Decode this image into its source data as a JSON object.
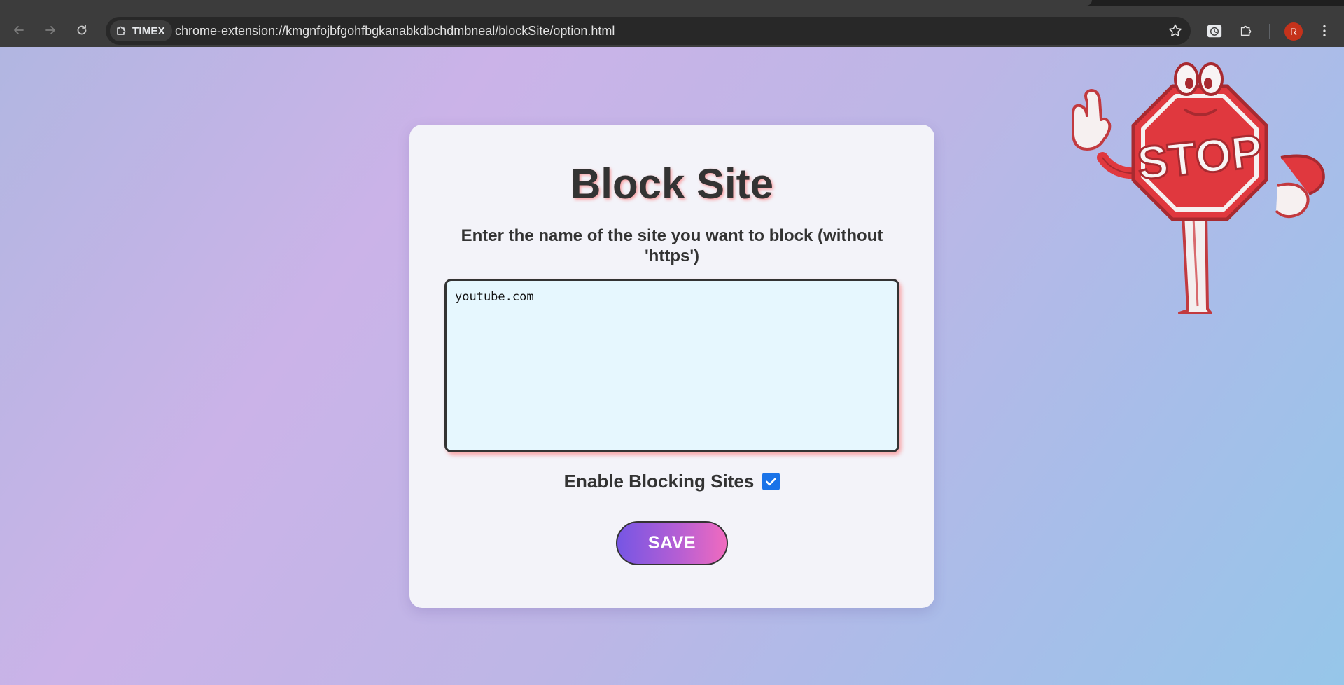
{
  "browser": {
    "site_chip_label": "TIMEX",
    "url": "chrome-extension://kmgnfojbfgohfbgkanabkdbchdmbneal/blockSite/option.html",
    "profile_initial": "R",
    "icons": [
      "back-arrow-icon",
      "forward-arrow-icon",
      "reload-icon",
      "extension-puzzle-icon",
      "bookmark-star-icon",
      "timer-extension-icon",
      "extensions-icon",
      "kebab-menu-icon"
    ]
  },
  "page": {
    "title": "Block Site",
    "instructions": "Enter the name of the site you want to block (without 'https')",
    "sites_value": "youtube.com",
    "enable_label": "Enable Blocking Sites",
    "enable_checked": true,
    "save_label": "SAVE",
    "stop_sign_text": "STOP",
    "colors": {
      "gradient_start": "#7656e4",
      "gradient_end": "#f06bbf",
      "stop_red": "#e0383e",
      "checkbox_blue": "#1a73e8"
    }
  }
}
